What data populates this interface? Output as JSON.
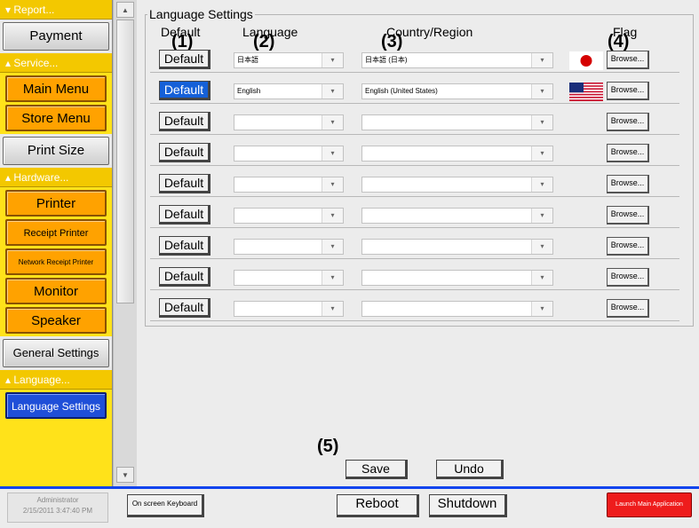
{
  "sidebar": {
    "sections": {
      "report": "Report...",
      "service": "Service...",
      "hardware": "Hardware...",
      "language": "Language..."
    },
    "buttons": {
      "payment": "Payment",
      "main_menu": "Main Menu",
      "store_menu": "Store Menu",
      "print_size": "Print Size",
      "printer": "Printer",
      "receipt_printer": "Receipt Printer",
      "network_receipt_printer": "Network Receipt Printer",
      "monitor": "Monitor",
      "speaker": "Speaker",
      "general_settings": "General Settings",
      "language_settings": "Language Settings"
    }
  },
  "panel": {
    "title": "Language Settings",
    "headers": {
      "default": "Default",
      "language": "Language",
      "country": "Country/Region",
      "flag": "Flag"
    },
    "markers": [
      "(1)",
      "(2)",
      "(3)",
      "(4)",
      "(5)"
    ],
    "rows": [
      {
        "default_label": "Default",
        "language": "日本語",
        "country": "日本語 (日本)",
        "flag": "jp",
        "browse": "Browse..."
      },
      {
        "default_label": "Default",
        "language": "English",
        "country": "English (United States)",
        "flag": "us",
        "browse": "Browse..."
      },
      {
        "default_label": "Default",
        "language": "",
        "country": "",
        "flag": "",
        "browse": "Browse..."
      },
      {
        "default_label": "Default",
        "language": "",
        "country": "",
        "flag": "",
        "browse": "Browse..."
      },
      {
        "default_label": "Default",
        "language": "",
        "country": "",
        "flag": "",
        "browse": "Browse..."
      },
      {
        "default_label": "Default",
        "language": "",
        "country": "",
        "flag": "",
        "browse": "Browse..."
      },
      {
        "default_label": "Default",
        "language": "",
        "country": "",
        "flag": "",
        "browse": "Browse..."
      },
      {
        "default_label": "Default",
        "language": "",
        "country": "",
        "flag": "",
        "browse": "Browse..."
      },
      {
        "default_label": "Default",
        "language": "",
        "country": "",
        "flag": "",
        "browse": "Browse..."
      }
    ],
    "save_label": "Save",
    "undo_label": "Undo"
  },
  "statusbar": {
    "user": "Administrator",
    "datetime": "2/15/2011 3:47:40 PM",
    "osk_label": "On screen Keyboard",
    "reboot_label": "Reboot",
    "shutdown_label": "Shutdown",
    "launch_label": "Launch Main Application"
  },
  "colors": {
    "sidebar_bg": "#ffe21a",
    "orange_button": "#ffa200",
    "active_button": "#1f4fd8",
    "status_border": "#1144ee",
    "launch_button": "#ee1c1c"
  }
}
